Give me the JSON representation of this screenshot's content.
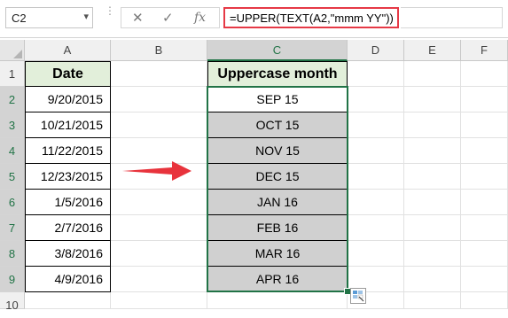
{
  "formula_bar": {
    "name_box": "C2",
    "cancel_icon": "close-icon",
    "enter_icon": "check-icon",
    "fx_label": "fx",
    "formula": "=UPPER(TEXT(A2,\"mmm YY\"))"
  },
  "columns": [
    "A",
    "B",
    "C",
    "D",
    "E",
    "F"
  ],
  "rows": [
    "1",
    "2",
    "3",
    "4",
    "5",
    "6",
    "7",
    "8",
    "9",
    "10"
  ],
  "headers": {
    "date": "Date",
    "uppercase_month": "Uppercase month"
  },
  "dates": [
    "9/20/2015",
    "10/21/2015",
    "11/22/2015",
    "12/23/2015",
    "1/5/2016",
    "2/7/2016",
    "3/8/2016",
    "4/9/2016"
  ],
  "months": [
    "SEP 15",
    "OCT 15",
    "NOV 15",
    "DEC 15",
    "JAN 16",
    "FEB 16",
    "MAR 16",
    "APR 16"
  ],
  "colors": {
    "accent": "#217346",
    "formula_highlight": "#e63946",
    "header_fill": "#e2efda",
    "selection_fill": "#d0d0d0"
  }
}
